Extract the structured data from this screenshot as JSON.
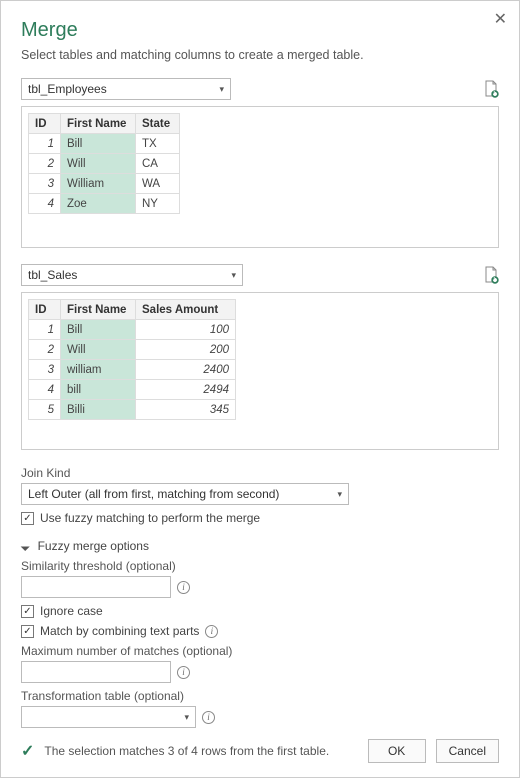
{
  "title": "Merge",
  "subtitle": "Select tables and matching columns to create a merged table.",
  "table1": {
    "name": "tbl_Employees",
    "columns": [
      "ID",
      "First Name",
      "State"
    ],
    "rows": [
      {
        "id": "1",
        "name": "Bill",
        "c3": "TX"
      },
      {
        "id": "2",
        "name": "Will",
        "c3": "CA"
      },
      {
        "id": "3",
        "name": "William",
        "c3": "WA"
      },
      {
        "id": "4",
        "name": "Zoe",
        "c3": "NY"
      }
    ]
  },
  "table2": {
    "name": "tbl_Sales",
    "columns": [
      "ID",
      "First Name",
      "Sales Amount"
    ],
    "rows": [
      {
        "id": "1",
        "name": "Bill",
        "c3": "100"
      },
      {
        "id": "2",
        "name": "Will",
        "c3": "200"
      },
      {
        "id": "3",
        "name": "william",
        "c3": "2400"
      },
      {
        "id": "4",
        "name": "bill",
        "c3": "2494"
      },
      {
        "id": "5",
        "name": "Billi",
        "c3": "345"
      }
    ]
  },
  "join": {
    "label": "Join Kind",
    "selected": "Left Outer (all from first, matching from second)"
  },
  "fuzzy": {
    "use_label": "Use fuzzy matching to perform the merge",
    "use_checked": true,
    "section_title": "Fuzzy merge options",
    "similarity_label": "Similarity threshold (optional)",
    "ignore_case_label": "Ignore case",
    "ignore_case_checked": true,
    "combine_label": "Match by combining text parts",
    "combine_checked": true,
    "max_matches_label": "Maximum number of matches (optional)",
    "transform_label": "Transformation table (optional)"
  },
  "status": "The selection matches 3 of 4 rows from the first table.",
  "buttons": {
    "ok": "OK",
    "cancel": "Cancel"
  }
}
